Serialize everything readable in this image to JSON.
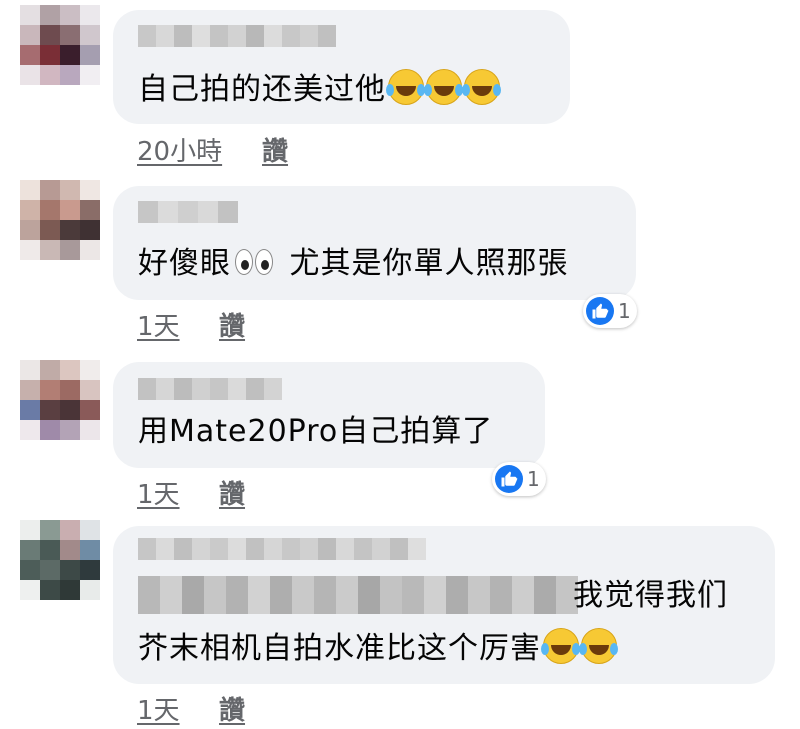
{
  "comments": [
    {
      "lines": [
        "自己拍的还美过他"
      ],
      "emoji_after": [
        "grinning-tears-emoji",
        "grinning-tears-emoji",
        "grinning-tears-emoji"
      ],
      "time": "20小時",
      "like_label": "讚",
      "reactions": null
    },
    {
      "text_before_eyes": "好傻眼",
      "text_after_eyes": " 尤其是你單人照那張",
      "time": "1天",
      "like_label": "讚",
      "reactions": {
        "icon": "thumbs-up-icon",
        "count": "1"
      }
    },
    {
      "lines": [
        "用Mate20Pro自己拍算了"
      ],
      "time": "1天",
      "like_label": "讚",
      "reactions": {
        "icon": "thumbs-up-icon",
        "count": "1"
      }
    },
    {
      "line1_visible": "我觉得我们",
      "line2": "芥末相机自拍水准比这个厉害",
      "emoji_after": [
        "grinning-tears-emoji",
        "grinning-tears-emoji"
      ],
      "time": "1天",
      "like_label": "讚",
      "reactions": null
    }
  ],
  "colors": {
    "bubble": "#f0f2f5",
    "meta_text": "#65676b",
    "like_blue": "#1877f2",
    "emoji_yellow": "#f7c934"
  }
}
